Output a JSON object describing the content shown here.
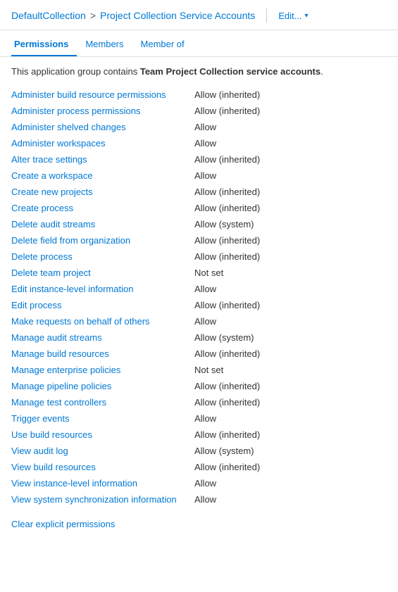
{
  "header": {
    "breadcrumb_parent": "DefaultCollection",
    "breadcrumb_separator": ">",
    "breadcrumb_current": "Project Collection Service Accounts",
    "edit_label": "Edit...",
    "edit_chevron": "▾"
  },
  "tabs": [
    {
      "label": "Permissions",
      "active": true
    },
    {
      "label": "Members",
      "active": false
    },
    {
      "label": "Member of",
      "active": false
    }
  ],
  "description": {
    "prefix": "This application group contains ",
    "highlight": "Team Project Collection service accounts",
    "suffix": "."
  },
  "permissions": [
    {
      "name": "Administer build resource permissions",
      "value": "Allow (inherited)"
    },
    {
      "name": "Administer process permissions",
      "value": "Allow (inherited)"
    },
    {
      "name": "Administer shelved changes",
      "value": "Allow"
    },
    {
      "name": "Administer workspaces",
      "value": "Allow"
    },
    {
      "name": "Alter trace settings",
      "value": "Allow (inherited)"
    },
    {
      "name": "Create a workspace",
      "value": "Allow"
    },
    {
      "name": "Create new projects",
      "value": "Allow (inherited)"
    },
    {
      "name": "Create process",
      "value": "Allow (inherited)"
    },
    {
      "name": "Delete audit streams",
      "value": "Allow (system)"
    },
    {
      "name": "Delete field from organization",
      "value": "Allow (inherited)"
    },
    {
      "name": "Delete process",
      "value": "Allow (inherited)"
    },
    {
      "name": "Delete team project",
      "value": "Not set"
    },
    {
      "name": "Edit instance-level information",
      "value": "Allow"
    },
    {
      "name": "Edit process",
      "value": "Allow (inherited)"
    },
    {
      "name": "Make requests on behalf of others",
      "value": "Allow"
    },
    {
      "name": "Manage audit streams",
      "value": "Allow (system)"
    },
    {
      "name": "Manage build resources",
      "value": "Allow (inherited)"
    },
    {
      "name": "Manage enterprise policies",
      "value": "Not set"
    },
    {
      "name": "Manage pipeline policies",
      "value": "Allow (inherited)"
    },
    {
      "name": "Manage test controllers",
      "value": "Allow (inherited)"
    },
    {
      "name": "Trigger events",
      "value": "Allow"
    },
    {
      "name": "Use build resources",
      "value": "Allow (inherited)"
    },
    {
      "name": "View audit log",
      "value": "Allow (system)"
    },
    {
      "name": "View build resources",
      "value": "Allow (inherited)"
    },
    {
      "name": "View instance-level information",
      "value": "Allow"
    },
    {
      "name": "View system synchronization information",
      "value": "Allow"
    }
  ],
  "clear_label": "Clear explicit permissions"
}
